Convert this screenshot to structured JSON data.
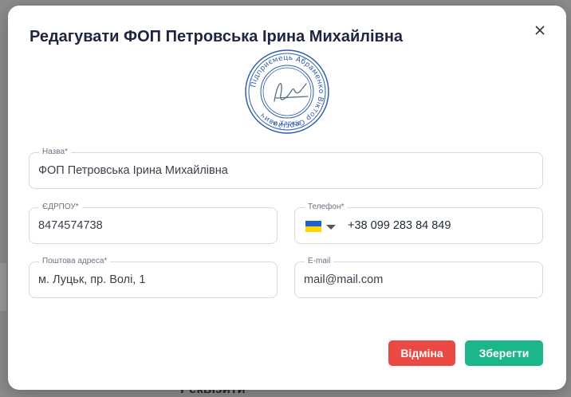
{
  "background": {
    "heading": "Реквізити"
  },
  "modal": {
    "title": "Редагувати ФОП Петровська Ірина Михайлівна",
    "stamp": {
      "outer_text": "Підприємець Абраменко Віктор Сергійович",
      "bottom_text": "м Харків"
    },
    "fields": {
      "name": {
        "label": "Назва*",
        "value": "ФОП Петровська Ірина Михайлівна"
      },
      "edrpou": {
        "label": "ЄДРПОУ*",
        "value": "8474574738"
      },
      "phone": {
        "label": "Телефон*",
        "value": "+38 099 283 84 849",
        "country_flag": "ukraine-flag-icon"
      },
      "address": {
        "label": "Поштова адреса*",
        "value": "м. Луцьк, пр. Волі, 1"
      },
      "email": {
        "label": "E-mail",
        "value": "mail@mail.com"
      }
    },
    "buttons": {
      "cancel": "Відміна",
      "save": "Зберегти"
    },
    "colors": {
      "cancel": "#ea4a43",
      "save": "#1db68a",
      "stamp": "#2f5fa8"
    }
  }
}
